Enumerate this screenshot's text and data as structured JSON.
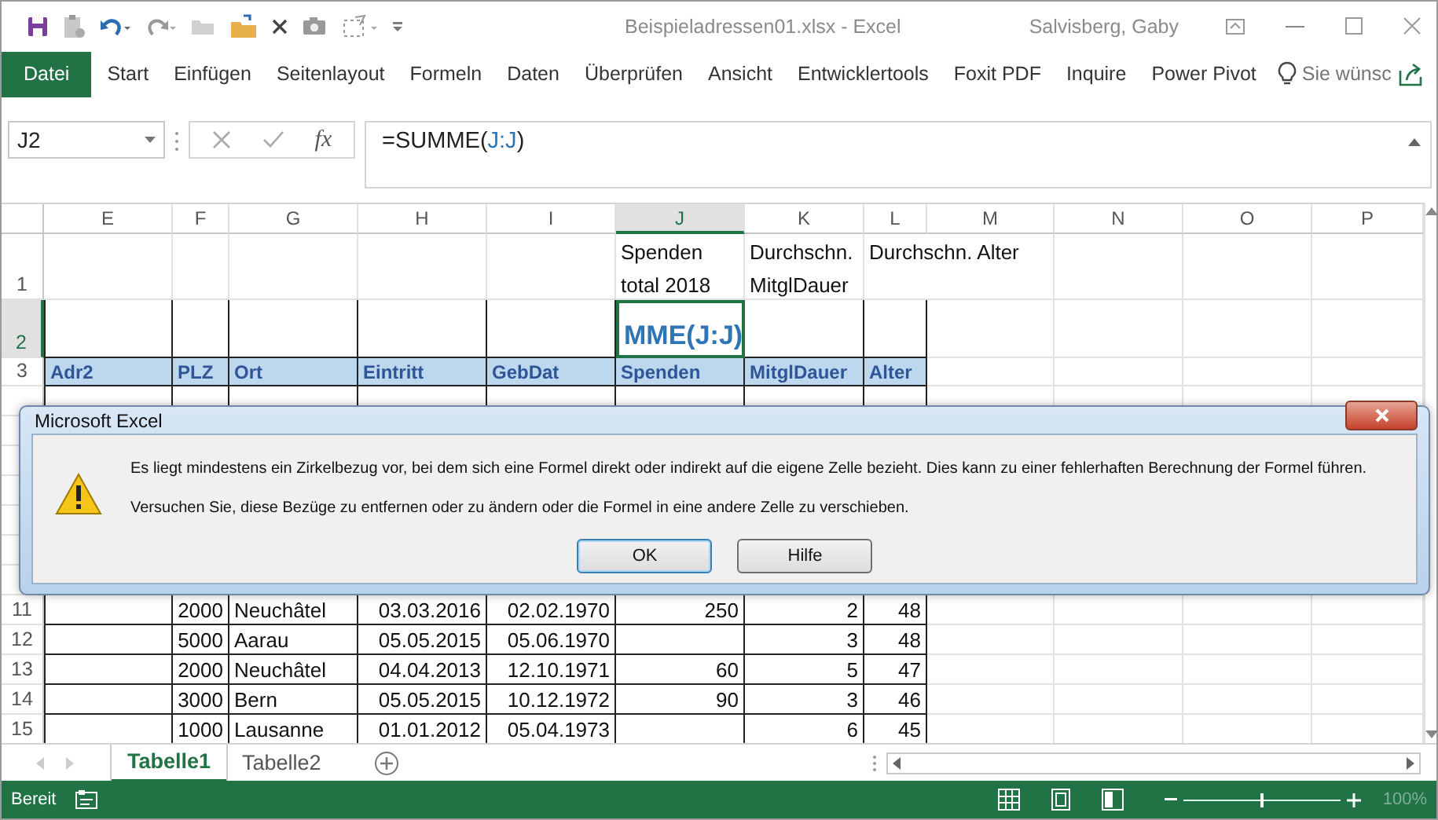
{
  "title_bar": {
    "document_title": "Beispieladressen01.xlsx  -  Excel",
    "user": "Salvisberg, Gaby"
  },
  "ribbon_tabs": [
    {
      "label": "Datei",
      "kind": "file"
    },
    {
      "label": "Start",
      "kind": "tab"
    },
    {
      "label": "Einfügen",
      "kind": "tab"
    },
    {
      "label": "Seitenlayout",
      "kind": "tab"
    },
    {
      "label": "Formeln",
      "kind": "tab"
    },
    {
      "label": "Daten",
      "kind": "tab"
    },
    {
      "label": "Überprüfen",
      "kind": "tab"
    },
    {
      "label": "Ansicht",
      "kind": "tab"
    },
    {
      "label": "Entwicklertools",
      "kind": "tab"
    },
    {
      "label": "Foxit PDF",
      "kind": "tab"
    },
    {
      "label": "Inquire",
      "kind": "tab"
    },
    {
      "label": "Power Pivot",
      "kind": "tab"
    }
  ],
  "tell_me": {
    "placeholder": "Sie wünsc"
  },
  "formula_bar": {
    "name_box": "J2",
    "function_label": "fx",
    "formula": [
      {
        "text": "=SUMME(",
        "reference": false
      },
      {
        "text": "J:J",
        "reference": true
      },
      {
        "text": ")",
        "reference": false
      }
    ]
  },
  "sheet": {
    "columns": [
      {
        "letter": "E",
        "selected": false
      },
      {
        "letter": "F",
        "selected": false
      },
      {
        "letter": "G",
        "selected": false
      },
      {
        "letter": "H",
        "selected": false
      },
      {
        "letter": "I",
        "selected": false
      },
      {
        "letter": "J",
        "selected": true
      },
      {
        "letter": "K",
        "selected": false
      },
      {
        "letter": "L",
        "selected": false
      },
      {
        "letter": "M",
        "selected": false
      },
      {
        "letter": "N",
        "selected": false
      },
      {
        "letter": "O",
        "selected": false
      },
      {
        "letter": "P",
        "selected": false
      }
    ],
    "rows": [
      {
        "number": "1",
        "kind": "caption",
        "selected": false,
        "cells": {
          "J": "Spenden\ntotal 2018",
          "K": "Durchschn.\nMitglDauer",
          "L": "Durchschn. Alter"
        }
      },
      {
        "number": "2",
        "kind": "entry",
        "selected": true,
        "cells": {
          "J": {
            "text": "MME(J:J)",
            "editing": true
          }
        }
      },
      {
        "number": "3",
        "kind": "header",
        "selected": false,
        "cells": {
          "E": "Adr2",
          "F": "PLZ",
          "G": "Ort",
          "H": "Eintritt",
          "I": "GebDat",
          "J": "Spenden",
          "K": "MitglDauer",
          "L": "Alter"
        }
      },
      {
        "number": "11",
        "kind": "data",
        "selected": false,
        "cells": {
          "F": "2000",
          "G": "Neuchâtel",
          "H": "03.03.2016",
          "I": "02.02.1970",
          "J": "250",
          "K": "2",
          "L": "48"
        }
      },
      {
        "number": "12",
        "kind": "data",
        "selected": false,
        "cells": {
          "F": "5000",
          "G": "Aarau",
          "H": "05.05.2015",
          "I": "05.06.1970",
          "K": "3",
          "L": "48"
        }
      },
      {
        "number": "13",
        "kind": "data",
        "selected": false,
        "cells": {
          "F": "2000",
          "G": "Neuchâtel",
          "H": "04.04.2013",
          "I": "12.10.1971",
          "J": "60",
          "K": "5",
          "L": "47"
        }
      },
      {
        "number": "14",
        "kind": "data",
        "selected": false,
        "cells": {
          "F": "3000",
          "G": "Bern",
          "H": "05.05.2015",
          "I": "10.12.1972",
          "J": "90",
          "K": "3",
          "L": "46"
        }
      },
      {
        "number": "15",
        "kind": "data",
        "selected": false,
        "cells": {
          "F": "1000",
          "G": "Lausanne",
          "H": "01.01.2012",
          "I": "05.04.1973",
          "K": "6",
          "L": "45"
        }
      }
    ]
  },
  "sheet_tabs": [
    {
      "label": "Tabelle1",
      "selected": true
    },
    {
      "label": "Tabelle2",
      "selected": false
    }
  ],
  "status_bar": {
    "status": "Bereit",
    "zoom": {
      "level": 0.5,
      "reading": "100%"
    }
  },
  "dialog": {
    "title": "Microsoft Excel",
    "messages": [
      "Es liegt mindestens ein Zirkelbezug vor, bei dem sich eine Formel direkt oder indirekt auf die eigene Zelle bezieht. Dies kann zu einer fehlerhaften Berechnung der Formel führen.",
      "Versuchen Sie, diese Bezüge zu entfernen oder zu ändern oder die Formel in eine andere Zelle zu verschieben."
    ],
    "buttons": [
      {
        "label": "OK",
        "focused": true
      },
      {
        "label": "Hilfe",
        "focused": false
      }
    ]
  }
}
